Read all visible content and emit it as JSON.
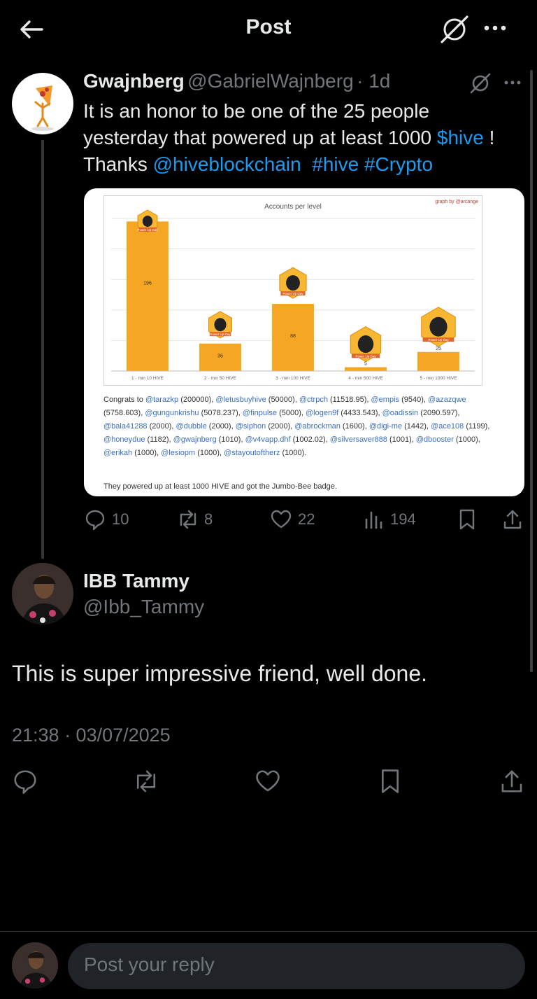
{
  "header": {
    "title": "Post"
  },
  "tweet": {
    "name": "Gwajnberg",
    "handle": "@GabrielWajnberg",
    "age": "· 1d",
    "line1": "It is an honor to be one of the 25 people",
    "line2_a": "yesterday that powered up at least 1000 ",
    "line2_tag": "$hive",
    "line2_b": " !",
    "line3_a": "Thanks ",
    "line3_mention": "@hiveblockchain",
    "line3_tag1": "#hive",
    "line3_tag2": "#Crypto",
    "stats": {
      "replies": "10",
      "reposts": "8",
      "likes": "22",
      "views": "194"
    }
  },
  "card": {
    "credit": "graph by @arcange",
    "badge_text": "Power Up Day",
    "congrats_prefix": "Congrats to",
    "mentions": [
      {
        "user": "@tarazkp",
        "amount": "(200000),"
      },
      {
        "user": "@letusbuyhive",
        "amount": "(50000),"
      },
      {
        "user": "@ctrpch",
        "amount": "(11518.95),"
      },
      {
        "user": "@empis",
        "amount": "(9540),"
      },
      {
        "user": "@azazqwe",
        "amount": "(5758.603),"
      },
      {
        "user": "@gungunkrishu",
        "amount": "(5078.237),"
      },
      {
        "user": "@finpulse",
        "amount": "(5000),"
      },
      {
        "user": "@logen9f",
        "amount": "(4433.543),"
      },
      {
        "user": "@oadissin",
        "amount": "(2090.597),"
      },
      {
        "user": "@bala41288",
        "amount": "(2000),"
      },
      {
        "user": "@dubble",
        "amount": "(2000),"
      },
      {
        "user": "@siphon",
        "amount": "(2000),"
      },
      {
        "user": "@abrockman",
        "amount": "(1600),"
      },
      {
        "user": "@digi-me",
        "amount": "(1442),"
      },
      {
        "user": "@ace108",
        "amount": "(1199),"
      },
      {
        "user": "@honeydue",
        "amount": "(1182),"
      },
      {
        "user": "@gwajnberg",
        "amount": "(1010),"
      },
      {
        "user": "@v4vapp.dhf",
        "amount": "(1002.02),"
      },
      {
        "user": "@silversaver888",
        "amount": "(1001),"
      },
      {
        "user": "@dbooster",
        "amount": "(1000),"
      },
      {
        "user": "@erikah",
        "amount": "(1000),"
      },
      {
        "user": "@lesiopm",
        "amount": "(1000),"
      },
      {
        "user": "@stayoutoftherz",
        "amount": "(1000)."
      }
    ],
    "footer": "They powered up at least 1000 HIVE and got the Jumbo-Bee badge."
  },
  "chart_data": {
    "type": "bar",
    "title": "Accounts per level",
    "categories": [
      "1 - min 10 HIVE",
      "2 - min 50 HIVE",
      "3 - min 100 HIVE",
      "4 - min 500 HIVE",
      "5 - min 1000 HIVE"
    ],
    "values": [
      196,
      36,
      88,
      5,
      25
    ],
    "ylim": [
      0,
      200
    ],
    "grid": true,
    "colors": {
      "bar": "#f5a623"
    }
  },
  "reply": {
    "name": "IBB Tammy",
    "handle": "@Ibb_Tammy",
    "text": "This is super impressive friend, well done.",
    "timestamp": "21:38 · 03/07/2025"
  },
  "composer": {
    "placeholder": "Post your reply"
  },
  "colors": {
    "accent": "#1d9bf0",
    "muted": "#71767b",
    "text": "#e7e9ea",
    "background": "#000000"
  }
}
